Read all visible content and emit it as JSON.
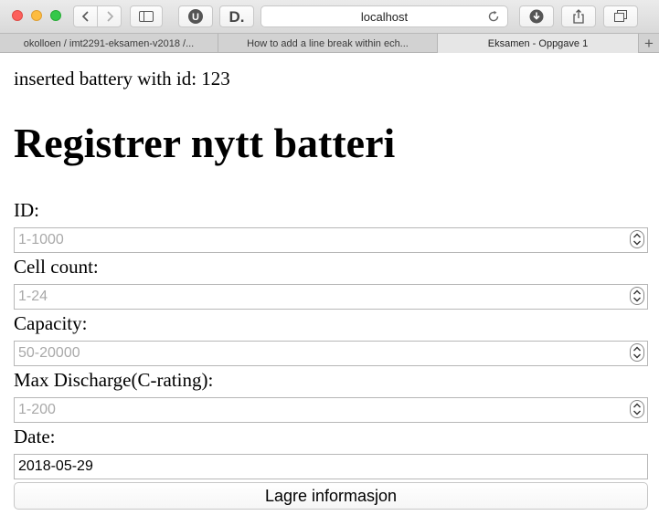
{
  "browser": {
    "address": "localhost",
    "tabs": [
      {
        "label": "okolloen / imt2291-eksamen-v2018 /..."
      },
      {
        "label": "How to add a line break within ech..."
      },
      {
        "label": "Eksamen - Oppgave 1"
      }
    ],
    "new_tab_label": "+",
    "extensions": {
      "u_label": "U",
      "d_label": "D."
    }
  },
  "page": {
    "status_message": "inserted battery with id: 123",
    "title": "Registrer nytt batteri",
    "fields": [
      {
        "label": "ID:",
        "placeholder": "1-1000",
        "value": ""
      },
      {
        "label": "Cell count:",
        "placeholder": "1-24",
        "value": ""
      },
      {
        "label": "Capacity:",
        "placeholder": "50-20000",
        "value": ""
      },
      {
        "label": "Max Discharge(C-rating):",
        "placeholder": "1-200",
        "value": ""
      },
      {
        "label": "Date:",
        "placeholder": "",
        "value": "2018-05-29"
      }
    ],
    "submit_label": "Lagre informasjon"
  }
}
